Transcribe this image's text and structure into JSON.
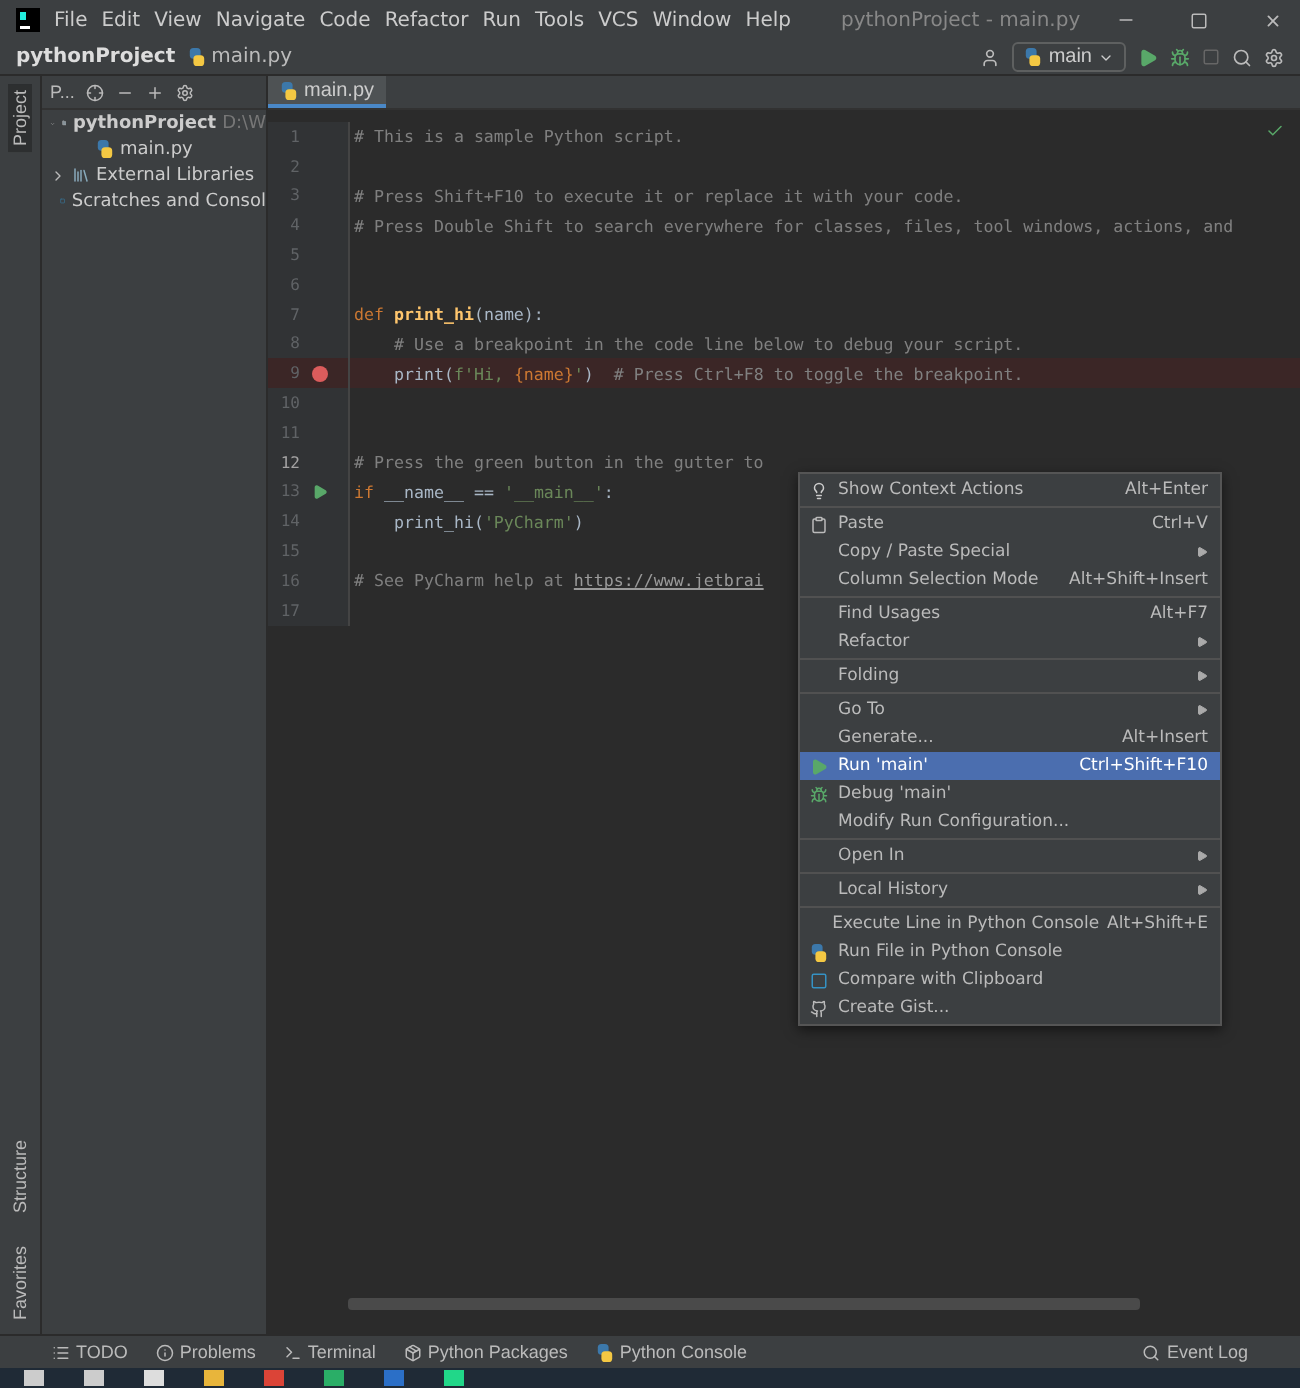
{
  "menu_bar": {
    "items": [
      "File",
      "Edit",
      "View",
      "Navigate",
      "Code",
      "Refactor",
      "Run",
      "Tools",
      "VCS",
      "Window",
      "Help"
    ],
    "title": "pythonProject - main.py"
  },
  "nav_bar": {
    "breadcrumbs": [
      "pythonProject",
      "main.py"
    ],
    "run_config": "main"
  },
  "left_stripe": {
    "top": "Project",
    "bottom": [
      "Structure",
      "Favorites"
    ]
  },
  "project_panel": {
    "view": "P...",
    "tree": [
      {
        "label": "pythonProject",
        "path": "D:\\W",
        "expanded": true,
        "children": [
          {
            "label": "main.py"
          }
        ]
      },
      {
        "label": "External Libraries",
        "expanded": false
      },
      {
        "label": "Scratches and Consol"
      }
    ]
  },
  "editor": {
    "tab": "main.py",
    "lines": [
      {
        "number": "1",
        "current": false,
        "breakpoint": false,
        "run_marker": false,
        "segments": [
          {
            "kind": "comment",
            "text": "# This is a sample Python script."
          }
        ]
      },
      {
        "number": "2",
        "current": false,
        "breakpoint": false,
        "run_marker": false
      },
      {
        "number": "3",
        "current": false,
        "breakpoint": false,
        "run_marker": false,
        "segments": [
          {
            "kind": "comment",
            "text": "# Press Shift+F10 to execute it or replace it with your code."
          }
        ]
      },
      {
        "number": "4",
        "current": false,
        "breakpoint": false,
        "run_marker": false,
        "segments": [
          {
            "kind": "comment",
            "text": "# Press Double Shift to search everywhere for classes, files, tool windows, actions, and"
          }
        ]
      },
      {
        "number": "5",
        "current": false,
        "breakpoint": false,
        "run_marker": false
      },
      {
        "number": "6",
        "current": false,
        "breakpoint": false,
        "run_marker": false
      },
      {
        "number": "7",
        "current": false,
        "breakpoint": false,
        "run_marker": false,
        "segments": [
          {
            "kind": "keyword",
            "text": "def "
          },
          {
            "kind": "func",
            "text": "print_hi"
          },
          {
            "kind": "plain",
            "text": "(name):"
          }
        ]
      },
      {
        "number": "8",
        "current": false,
        "breakpoint": false,
        "run_marker": false,
        "segments": [
          {
            "kind": "comment",
            "text": "    # Use a breakpoint in the code line below to debug your script."
          }
        ]
      },
      {
        "number": "9",
        "current": false,
        "breakpoint": true,
        "run_marker": false,
        "segments": [
          {
            "kind": "plain",
            "text": "    print("
          },
          {
            "kind": "string",
            "text": "f'Hi, "
          },
          {
            "kind": "keyword",
            "text": "{name}"
          },
          {
            "kind": "string",
            "text": "'"
          },
          {
            "kind": "plain",
            "text": ")  "
          },
          {
            "kind": "comment",
            "text": "# Press Ctrl+F8 to toggle the breakpoint."
          }
        ]
      },
      {
        "number": "10",
        "current": false,
        "breakpoint": false,
        "run_marker": false
      },
      {
        "number": "11",
        "current": false,
        "breakpoint": false,
        "run_marker": false
      },
      {
        "number": "12",
        "current": true,
        "breakpoint": false,
        "run_marker": false,
        "segments": [
          {
            "kind": "comment",
            "text": "# Press the green button in the gutter to"
          }
        ]
      },
      {
        "number": "13",
        "current": false,
        "breakpoint": false,
        "run_marker": true,
        "segments": [
          {
            "kind": "keyword",
            "text": "if "
          },
          {
            "kind": "plain",
            "text": "__name__ == "
          },
          {
            "kind": "string",
            "text": "'__main__'"
          },
          {
            "kind": "plain",
            "text": ":"
          }
        ]
      },
      {
        "number": "14",
        "current": false,
        "breakpoint": false,
        "run_marker": false,
        "segments": [
          {
            "kind": "plain",
            "text": "    print_hi("
          },
          {
            "kind": "string",
            "text": "'PyCharm'"
          },
          {
            "kind": "plain",
            "text": ")"
          }
        ]
      },
      {
        "number": "15",
        "current": false,
        "breakpoint": false,
        "run_marker": false
      },
      {
        "number": "16",
        "current": false,
        "breakpoint": false,
        "run_marker": false,
        "segments": [
          {
            "kind": "comment",
            "text": "# See PyCharm help at "
          },
          {
            "kind": "link",
            "text": "https://www.jetbrai"
          }
        ]
      },
      {
        "number": "17",
        "current": false,
        "breakpoint": false,
        "run_marker": false
      }
    ]
  },
  "context_menu": [
    {
      "label": "Show Context Actions",
      "shortcut": "Alt+Enter",
      "submenu": false,
      "selected": false,
      "separator_after": true
    },
    {
      "label": "Paste",
      "shortcut": "Ctrl+V",
      "submenu": false,
      "selected": false,
      "separator_after": false
    },
    {
      "label": "Copy / Paste Special",
      "submenu": true,
      "selected": false,
      "separator_after": false
    },
    {
      "label": "Column Selection Mode",
      "shortcut": "Alt+Shift+Insert",
      "submenu": false,
      "selected": false,
      "separator_after": true
    },
    {
      "label": "Find Usages",
      "shortcut": "Alt+F7",
      "submenu": false,
      "selected": false,
      "separator_after": false
    },
    {
      "label": "Refactor",
      "submenu": true,
      "selected": false,
      "separator_after": true
    },
    {
      "label": "Folding",
      "submenu": true,
      "selected": false,
      "separator_after": true
    },
    {
      "label": "Go To",
      "submenu": true,
      "selected": false,
      "separator_after": false
    },
    {
      "label": "Generate...",
      "shortcut": "Alt+Insert",
      "submenu": false,
      "selected": false,
      "separator_after": false
    },
    {
      "label": "Run 'main'",
      "shortcut": "Ctrl+Shift+F10",
      "submenu": false,
      "selected": true,
      "separator_after": false
    },
    {
      "label": "Debug 'main'",
      "submenu": false,
      "selected": false,
      "separator_after": false
    },
    {
      "label": "Modify Run Configuration...",
      "submenu": false,
      "selected": false,
      "separator_after": true
    },
    {
      "label": "Open In",
      "submenu": true,
      "selected": false,
      "separator_after": true
    },
    {
      "label": "Local History",
      "submenu": true,
      "selected": false,
      "separator_after": true
    },
    {
      "label": "Execute Line in Python Console",
      "shortcut": "Alt+Shift+E",
      "submenu": false,
      "selected": false,
      "separator_after": false
    },
    {
      "label": "Run File in Python Console",
      "submenu": false,
      "selected": false,
      "separator_after": false
    },
    {
      "label": "Compare with Clipboard",
      "submenu": false,
      "selected": false,
      "separator_after": false
    },
    {
      "label": "Create Gist...",
      "submenu": false,
      "selected": false,
      "separator_after": false
    }
  ],
  "tool_windows": [
    "TODO",
    "Problems",
    "Terminal",
    "Python Packages",
    "Python Console"
  ],
  "event_log": "Event Log"
}
